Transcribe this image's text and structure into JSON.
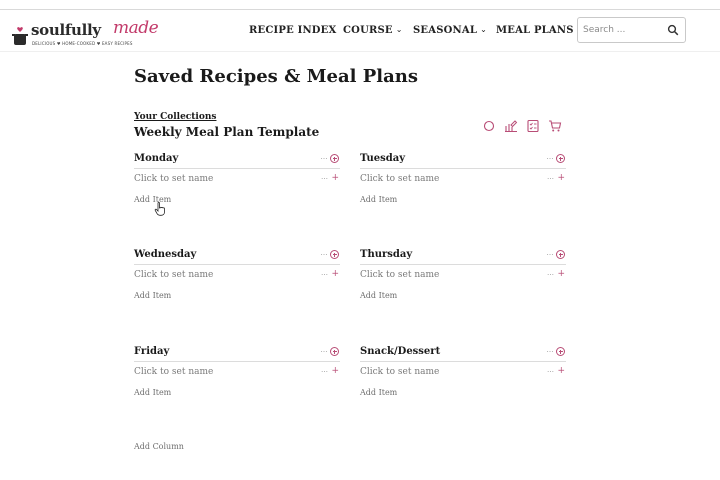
{
  "header": {
    "logo": {
      "word": "soulfully",
      "accent": "made",
      "tagline": "DELICIOUS ♥ HOME-COOKED ♥ EASY RECIPES",
      "accent_color": "#c23a6a"
    },
    "nav": [
      {
        "label": "RECIPE INDEX",
        "has_dropdown": false
      },
      {
        "label": "COURSE",
        "has_dropdown": true
      },
      {
        "label": "SEASONAL",
        "has_dropdown": true
      },
      {
        "label": "MEAL PLANS",
        "has_dropdown": false
      }
    ],
    "search": {
      "placeholder": "Search ...",
      "icon": "search-icon"
    }
  },
  "page": {
    "title": "Saved Recipes & Meal Plans",
    "collections_link": "Your Collections",
    "template_name": "Weekly Meal Plan Template",
    "toolbar_icons": [
      "circle-icon",
      "chart-edit-icon",
      "checklist-icon",
      "cart-icon"
    ],
    "accent_color": "#b84d76"
  },
  "columns": [
    {
      "title": "Monday",
      "item_placeholder": "Click to set name",
      "add_item": "Add Item"
    },
    {
      "title": "Tuesday",
      "item_placeholder": "Click to set name",
      "add_item": "Add Item"
    },
    {
      "title": "Wednesday",
      "item_placeholder": "Click to set name",
      "add_item": "Add Item"
    },
    {
      "title": "Thursday",
      "item_placeholder": "Click to set name",
      "add_item": "Add Item"
    },
    {
      "title": "Friday",
      "item_placeholder": "Click to set name",
      "add_item": "Add Item"
    },
    {
      "title": "Snack/Dessert",
      "item_placeholder": "Click to set name",
      "add_item": "Add Item"
    }
  ],
  "add_column": "Add Column"
}
